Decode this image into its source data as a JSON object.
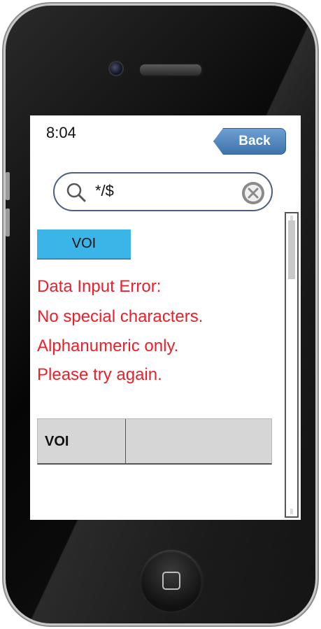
{
  "status_bar": {
    "time": "8:04"
  },
  "nav": {
    "back_label": "Back"
  },
  "search": {
    "value": "*/$"
  },
  "tag": {
    "label": "VOI"
  },
  "error": {
    "lines": [
      "Data Input Error:",
      "No special characters.",
      "Alphanumeric only.",
      "Please try again."
    ],
    "color": "#e8212b"
  },
  "table": {
    "header": "VOI",
    "cells": [
      "",
      ""
    ]
  },
  "colors": {
    "tag_bg": "#3bb4e8",
    "back_button": "#4f86c0"
  },
  "icons": [
    "search-icon",
    "clear-icon",
    "home-button-icon"
  ]
}
